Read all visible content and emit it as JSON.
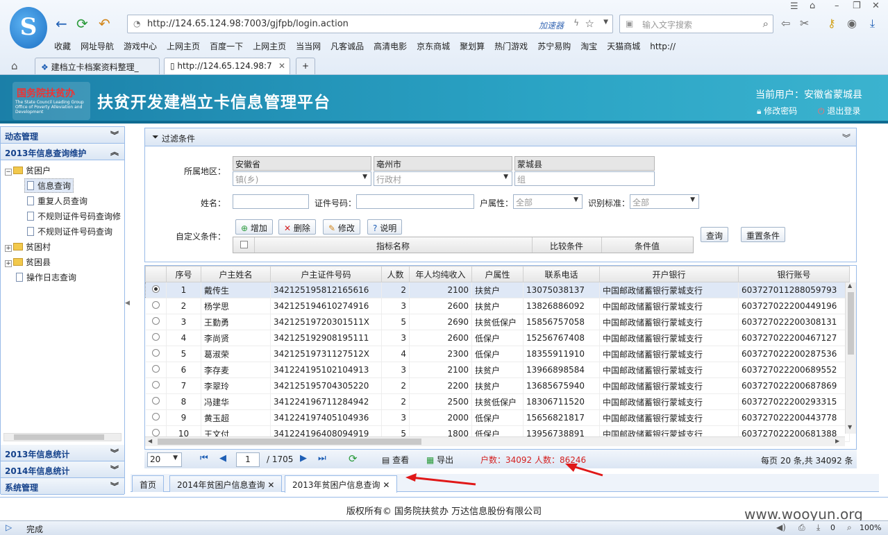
{
  "browser": {
    "logo_letter": "S",
    "url": "http://124.65.124.98:7003/gjfpb/login.action",
    "accelerator": "加速器",
    "search_placeholder": "输入文字搜索",
    "bookmarks": [
      "收藏",
      "网址导航",
      "游戏中心",
      "上网主页",
      "百度一下",
      "上网主页",
      "当当网",
      "凡客诚品",
      "高清电影",
      "京东商城",
      "聚划算",
      "热门游戏",
      "苏宁易购",
      "淘宝",
      "天猫商城",
      "http://"
    ],
    "tabs": [
      "建档立卡档案资料整理_",
      "http://124.65.124.98:7"
    ],
    "status": "完成",
    "zoom": "100%",
    "status_count": "0"
  },
  "app": {
    "badge_cn": "国务院扶贫办",
    "badge_en": "The State Council Leading Group Office of Poverty Alleviation and Development",
    "title": "扶贫开发建档立卡信息管理平台",
    "current_user": "当前用户：安徽省蒙城县",
    "change_password": "修改密码",
    "logout": "退出登录"
  },
  "sidebar": {
    "sections": [
      "动态管理",
      "2013年信息查询维护"
    ],
    "tree": {
      "poor_household": "贫困户",
      "children": [
        "信息查询",
        "重复人员查询",
        "不规则证件号码查询修",
        "不规则证件号码查询"
      ],
      "poor_village": "贫困村",
      "poor_county": "贫困县",
      "log_query": "操作日志查询"
    },
    "bottom_sections": [
      "2013年信息统计",
      "2014年信息统计",
      "系统管理"
    ]
  },
  "filter": {
    "header": "过滤条件",
    "region_label": "所属地区：",
    "province": "安徽省",
    "city": "亳州市",
    "county": "蒙城县",
    "town_placeholder": "镇(乡)",
    "village_placeholder": "行政村",
    "group_placeholder": "组",
    "name_label": "姓名：",
    "id_label": "证件号码：",
    "household_attr_label": "户属性：",
    "household_attr_value": "全部",
    "standard_label": "识别标准：",
    "standard_value": "全部",
    "custom_label": "自定义条件：",
    "buttons": {
      "add": "增加",
      "delete": "删除",
      "edit": "修改",
      "help": "说明",
      "query": "查询",
      "reset": "重置条件"
    },
    "cond_headers": [
      "指标名称",
      "比较条件",
      "条件值"
    ]
  },
  "grid": {
    "headers": [
      "序号",
      "户主姓名",
      "户主证件号码",
      "人数",
      "年人均纯收入",
      "户属性",
      "联系电话",
      "开户银行",
      "银行账号"
    ],
    "rows": [
      [
        "1",
        "戴传生",
        "342125195812165616",
        "2",
        "2100",
        "扶贫户",
        "13075038137",
        "中国邮政储蓄银行蒙城支行",
        "603727011288059793"
      ],
      [
        "2",
        "杨学思",
        "342125194610274916",
        "3",
        "2600",
        "扶贫户",
        "13826886092",
        "中国邮政储蓄银行蒙城支行",
        "603727022200449196"
      ],
      [
        "3",
        "王勤勇",
        "34212519720301511X",
        "5",
        "2690",
        "扶贫低保户",
        "15856757058",
        "中国邮政储蓄银行蒙城支行",
        "603727022200308131"
      ],
      [
        "4",
        "李尚贤",
        "342125192908195111",
        "3",
        "2600",
        "低保户",
        "15256767408",
        "中国邮政储蓄银行蒙城支行",
        "603727022200467127"
      ],
      [
        "5",
        "葛淑荣",
        "34212519731127512X",
        "4",
        "2300",
        "低保户",
        "18355911910",
        "中国邮政储蓄银行蒙城支行",
        "603727022200287536"
      ],
      [
        "6",
        "李存麦",
        "341224195102104913",
        "3",
        "2100",
        "扶贫户",
        "13966898584",
        "中国邮政储蓄银行蒙城支行",
        "603727022200689552"
      ],
      [
        "7",
        "李翠玲",
        "342125195704305220",
        "2",
        "2200",
        "扶贫户",
        "13685675940",
        "中国邮政储蓄银行蒙城支行",
        "603727022200687869"
      ],
      [
        "8",
        "冯建华",
        "341224196711284942",
        "2",
        "2500",
        "扶贫低保户",
        "18306711520",
        "中国邮政储蓄银行蒙城支行",
        "603727022200293315"
      ],
      [
        "9",
        "黄玉超",
        "341224197405104936",
        "3",
        "2000",
        "低保户",
        "15656821817",
        "中国邮政储蓄银行蒙城支行",
        "603727022200443778"
      ],
      [
        "10",
        "王文付",
        "341224196408094919",
        "5",
        "1800",
        "低保户",
        "13956738891",
        "中国邮政储蓄银行蒙城支行",
        "603727022200681388"
      ]
    ]
  },
  "pager": {
    "page_size": "20",
    "page": "1",
    "total_pages": "/ 1705",
    "view": "查看",
    "export": "导出",
    "summary": "户数：34092 人数：86246",
    "info": "每页 20 条,共 34092 条"
  },
  "bottom_tabs": [
    "首页",
    "2014年贫困户信息查询",
    "2013年贫困户信息查询"
  ],
  "footer": "版权所有© 国务院扶贫办 万达信息股份有限公司",
  "watermark": "www.wooyun.org"
}
